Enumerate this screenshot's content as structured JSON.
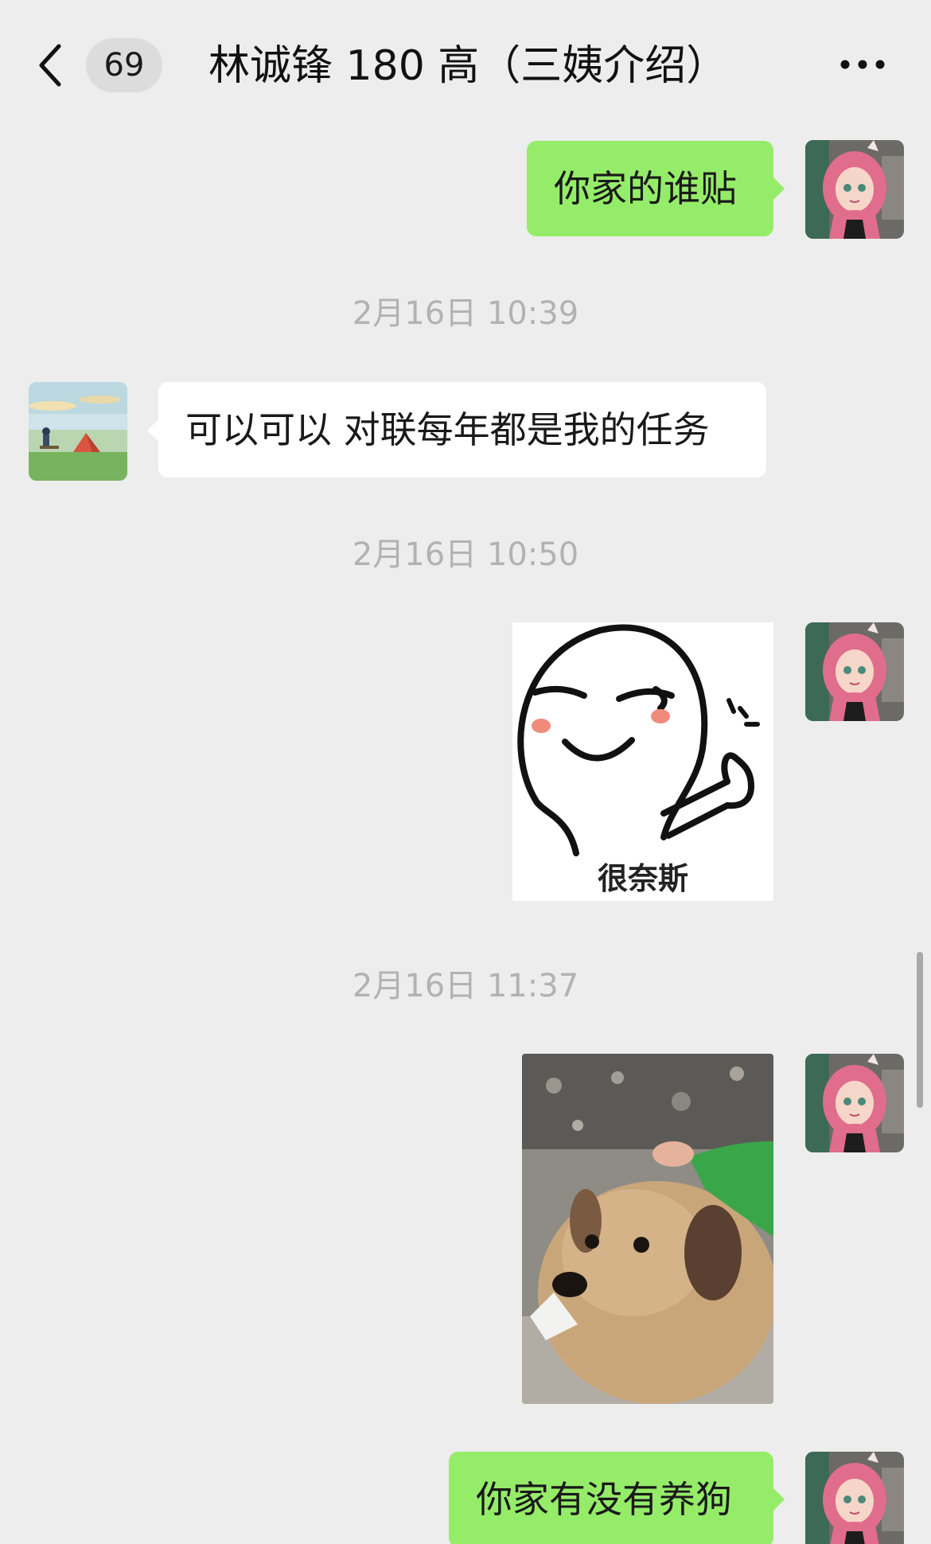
{
  "header": {
    "unread_count": "69",
    "title": "林诚锋 180 高（三姨介绍）"
  },
  "messages": [
    {
      "kind": "text",
      "side": "out",
      "text": "你家的谁贴"
    },
    {
      "kind": "time",
      "text": "2月16日 10:39"
    },
    {
      "kind": "text",
      "side": "in",
      "text": "可以可以 对联每年都是我的任务"
    },
    {
      "kind": "time",
      "text": "2月16日 10:50"
    },
    {
      "kind": "sticker",
      "side": "out",
      "caption": "很奈斯"
    },
    {
      "kind": "time",
      "text": "2月16日 11:37"
    },
    {
      "kind": "photo",
      "side": "out",
      "subject": "puppy"
    },
    {
      "kind": "text",
      "side": "out",
      "text": "你家有没有养狗"
    }
  ],
  "colors": {
    "background": "#ededed",
    "outgoing_bubble": "#95ec69",
    "incoming_bubble": "#ffffff",
    "timestamp": "#b2b2b2"
  },
  "icons": {
    "back": "chevron-left-icon",
    "more": "more-dots-icon"
  }
}
